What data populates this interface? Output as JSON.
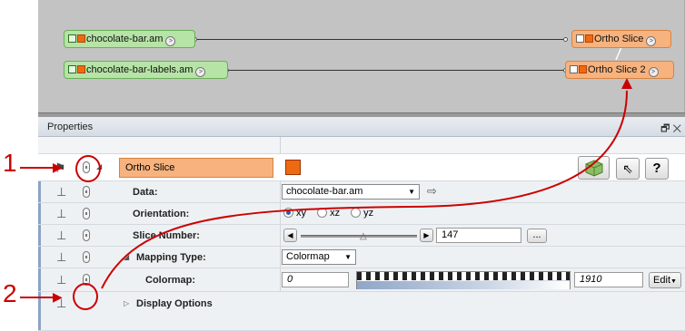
{
  "pool": {
    "nodes": [
      {
        "label": "chocolate-bar.am",
        "kind": "data"
      },
      {
        "label": "chocolate-bar-labels.am",
        "kind": "data"
      },
      {
        "label": "Ortho Slice",
        "kind": "module"
      },
      {
        "label": "Ortho Slice 2",
        "kind": "module"
      }
    ]
  },
  "properties": {
    "title": "Properties",
    "header_icon": "restore-icon",
    "module_name": "Ortho Slice",
    "module_color": "#ee6a12",
    "toolbar": [
      "cube-icon",
      "pointer-icon",
      "help-icon"
    ],
    "help_label": "?",
    "rows": {
      "data": {
        "label": "Data:",
        "value": "chocolate-bar.am"
      },
      "orientation": {
        "label": "Orientation:",
        "options": [
          "xy",
          "xz",
          "yz"
        ],
        "selected": "xy"
      },
      "slice": {
        "label": "Slice Number:",
        "value": "147",
        "more": "..."
      },
      "mapping": {
        "label": "Mapping Type:",
        "value": "Colormap"
      },
      "colormap": {
        "label": "Colormap:",
        "min": "0",
        "max": "1910",
        "edit": "Edit"
      },
      "display": {
        "label": "Display Options"
      }
    }
  },
  "callouts": {
    "one": "1",
    "two": "2"
  },
  "colors": {
    "accent": "#c00000",
    "node_green": "#b6e3a6",
    "node_orange": "#f7b27e"
  }
}
